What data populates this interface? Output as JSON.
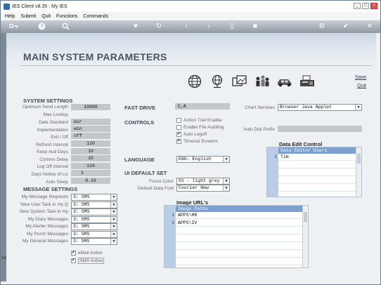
{
  "window": {
    "title": "IES Client v8.35 : My IES"
  },
  "menu": [
    "Help",
    "Submit",
    "Quit",
    "Functions",
    "Commands"
  ],
  "toolbar_icons": [
    "key-icon",
    "help-icon",
    "search-icon",
    "heart-icon",
    "refresh-icon",
    "back-icon",
    "forward-icon",
    "page-icon",
    "stop-icon",
    "settings-icon",
    "check-icon",
    "close-icon"
  ],
  "page": {
    "title": "MAIN SYSTEM PARAMETERS",
    "save_label": "Save",
    "quit_label": "Quit"
  },
  "header_icons": [
    "globe-icon",
    "network-globe-icon",
    "photo-icon",
    "people-icon",
    "car-icon",
    "fax-icon"
  ],
  "system_settings": {
    "heading": "SYSTEM SETTINGS",
    "fields": [
      {
        "label": "Optimum Send Length",
        "value": "10000"
      },
      {
        "label": "Max Lookup",
        "value": ""
      },
      {
        "label": "Date Standard",
        "value": "eur"
      },
      {
        "label": "Implementation",
        "value": "win"
      },
      {
        "label": "Exit / Off",
        "value": "off"
      },
      {
        "label": "Refresh Interval",
        "value": "120"
      },
      {
        "label": "Keep Aud Days",
        "value": "10"
      },
      {
        "label": "Comms Delay",
        "value": "10"
      },
      {
        "label": "Log Off Interval",
        "value": "120"
      },
      {
        "label": "Days Notice of Lic",
        "value": "1"
      },
      {
        "label": "Auto Sleep",
        "value": "0.10"
      }
    ]
  },
  "message_settings": {
    "heading": "MESSAGE SETTINGS",
    "fields": [
      {
        "label": "My Message Requests",
        "value": "3: SMS"
      },
      {
        "label": "New User Task in my Q",
        "value": "3: SMS"
      },
      {
        "label": "New System Task in my",
        "value": "3: SMS"
      },
      {
        "label": "My Diary Messages",
        "value": "3: SMS"
      },
      {
        "label": "My Alerter Messages",
        "value": "3: SMS"
      },
      {
        "label": "My Purch Messages",
        "value": "3: SMS"
      },
      {
        "label": "My General Messages",
        "value": "3: SMS"
      }
    ],
    "email_active": "eMail Active",
    "sms_active": "SMS Active"
  },
  "fast_drive": {
    "heading": "FAST DRIVE",
    "value": "C,A"
  },
  "controls": {
    "heading": "CONTROLS",
    "options": [
      {
        "label": "Action Trail Enable",
        "checked": false
      },
      {
        "label": "Enable File Auditing",
        "checked": false
      },
      {
        "label": "Auto Logoff",
        "checked": true
      },
      {
        "label": "Timeout Screens",
        "checked": true
      }
    ]
  },
  "language": {
    "heading": "LANGUAGE",
    "value": "ENG: English"
  },
  "ui_default": {
    "heading": "UI DEFAULT SET",
    "focus_color_label": "Focus Color",
    "focus_color_value": "01 - light grey",
    "data_font_label": "Default Data Font",
    "data_font_value": "Courier New"
  },
  "chart_services": {
    "label": "Chart Services",
    "value": "Browser Java Applet"
  },
  "auto_dial": {
    "label": "Auto Dial Prefix",
    "value": ""
  },
  "data_edit": {
    "heading": "Data Edit Control",
    "column": "Data Editor Users",
    "rows": [
      {
        "num": "1",
        "value": "Tim"
      }
    ]
  },
  "image_urls": {
    "heading": "Image URL's",
    "column": "Image Paths",
    "rows": [
      {
        "num": "1",
        "value": "APPS\\HR"
      },
      {
        "num": "2",
        "value": "APPS\\IV"
      }
    ]
  },
  "left_fragment": "Sel"
}
